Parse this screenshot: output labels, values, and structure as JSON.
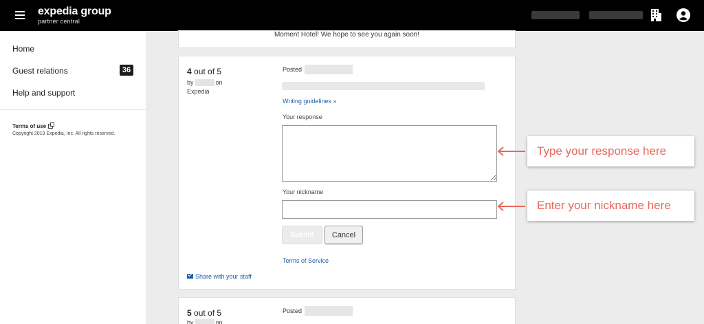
{
  "header": {
    "logo_main": "expedia group",
    "logo_sub": "partner central",
    "icons": [
      "menu-icon",
      "building-icon",
      "account-icon"
    ]
  },
  "sidebar": {
    "items": [
      {
        "label": "Home"
      },
      {
        "label": "Guest relations",
        "badge": "36"
      },
      {
        "label": "Help and support"
      }
    ],
    "terms": "Terms of use",
    "copyright": "Copyright 2019 Expedia, Inc. All rights reserved."
  },
  "previous_card": {
    "text": "Moment Hotel! We hope to see you again soon!"
  },
  "review": {
    "rating_value": "4",
    "rating_suffix": "out of 5",
    "by_prefix": "by",
    "by_suffix": "on",
    "source": "Expedia",
    "posted_label": "Posted",
    "guidelines_label": "Writing guidelines",
    "response_label": "Your response",
    "nickname_label": "Your nickname",
    "submit_label": "Submit",
    "cancel_label": "Cancel",
    "tos_label": "Terms of Service",
    "share_label": "Share with your staff"
  },
  "next_review": {
    "rating_value": "5",
    "rating_suffix": "out of 5",
    "by_prefix": "by",
    "by_suffix": "on",
    "posted_label": "Posted"
  },
  "callouts": {
    "response": "Type your response here",
    "nickname": "Enter your nickname here",
    "color": "#e8685b"
  },
  "colors": {
    "header_bg": "#000000",
    "link": "#1f5ea8",
    "page_bg": "#ececec"
  }
}
